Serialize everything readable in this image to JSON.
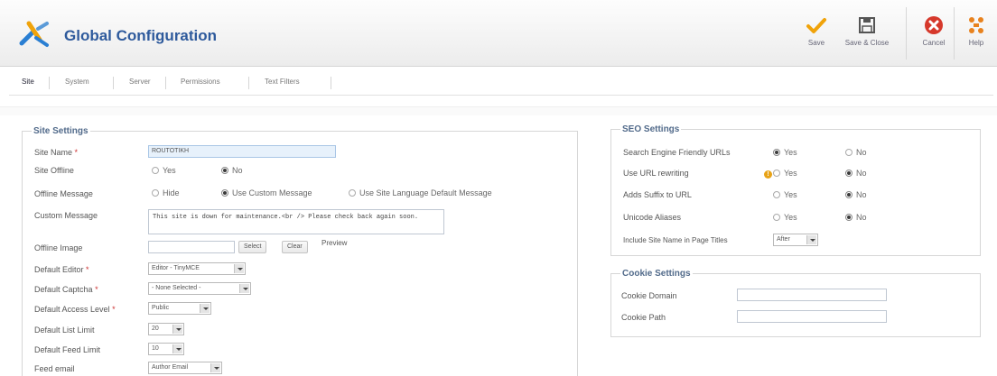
{
  "header": {
    "title": "Global Configuration"
  },
  "toolbar": [
    {
      "label": "Save",
      "icon": "check-icon"
    },
    {
      "label": "Save & Close",
      "icon": "save-icon"
    },
    {
      "label": "Cancel",
      "icon": "cancel-icon"
    },
    {
      "label": "Help",
      "icon": "help-icon"
    }
  ],
  "tabs": [
    "Site",
    "System",
    "Server",
    "Permissions",
    "Text Filters"
  ],
  "site_settings": {
    "legend": "Site Settings",
    "site_name": {
      "label": "Site Name",
      "required": "*",
      "value": "ROUTOTIKH"
    },
    "site_offline": {
      "label": "Site Offline",
      "options": [
        "Yes",
        "No"
      ],
      "selected": "No"
    },
    "offline_message": {
      "label": "Offline Message",
      "options": [
        "Hide",
        "Use Custom Message",
        "Use Site Language Default Message"
      ],
      "selected": "Use Custom Message"
    },
    "custom_message": {
      "label": "Custom Message",
      "value": "This site is down for maintenance.<br /> Please check back again soon."
    },
    "offline_image": {
      "label": "Offline Image",
      "value": "",
      "select_label": "Select",
      "clear_label": "Clear",
      "preview_label": "Preview"
    },
    "default_editor": {
      "label": "Default Editor",
      "required": "*",
      "value": "Editor - TinyMCE"
    },
    "default_captcha": {
      "label": "Default Captcha",
      "required": "*",
      "value": "- None Selected -"
    },
    "default_access_level": {
      "label": "Default Access Level",
      "required": "*",
      "value": "Public"
    },
    "default_list_limit": {
      "label": "Default List Limit",
      "value": "20"
    },
    "default_feed_limit": {
      "label": "Default Feed Limit",
      "value": "10"
    },
    "feed_email": {
      "label": "Feed email",
      "value": "Author Email"
    }
  },
  "seo_settings": {
    "legend": "SEO Settings",
    "sef_urls": {
      "label": "Search Engine Friendly URLs",
      "options": [
        "Yes",
        "No"
      ],
      "selected": "Yes"
    },
    "url_rewriting": {
      "label": "Use URL rewriting",
      "options": [
        "Yes",
        "No"
      ],
      "selected": "No"
    },
    "suffix_to_url": {
      "label": "Adds Suffix to URL",
      "options": [
        "Yes",
        "No"
      ],
      "selected": "No"
    },
    "unicode_aliases": {
      "label": "Unicode Aliases",
      "options": [
        "Yes",
        "No"
      ],
      "selected": "No"
    },
    "site_name_in_titles": {
      "label": "Include Site Name in Page Titles",
      "value": "After"
    }
  },
  "cookie_settings": {
    "legend": "Cookie Settings",
    "cookie_domain": {
      "label": "Cookie Domain",
      "value": ""
    },
    "cookie_path": {
      "label": "Cookie Path",
      "value": ""
    }
  },
  "colors": {
    "title": "#2e5a9c",
    "save_check": "#f0a30a",
    "cancel_red": "#d6382b",
    "help_orange": "#e8821e"
  }
}
